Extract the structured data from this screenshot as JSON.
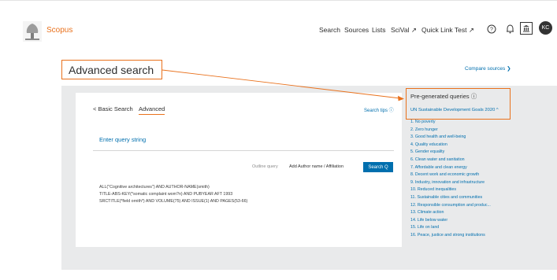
{
  "header": {
    "brand": "Scopus",
    "nav": [
      "Search",
      "Sources",
      "Lists",
      "SciVal ↗",
      "Quick Link Test ↗"
    ],
    "avatar_initials": "KC"
  },
  "page": {
    "title": "Advanced search",
    "compare_sources": "Compare sources ❯"
  },
  "search_card": {
    "tab_basic": "< Basic Search",
    "tab_advanced": "Advanced",
    "search_tips": "Search tips ⓘ",
    "query_placeholder": "Enter query string",
    "outline_query": "Outline query",
    "add_author": "Add Author name / Affiliation",
    "search_button": "Search Q",
    "examples": [
      "ALL(\"Cognitive architectures\") AND AUTHOR-NAME(smith)",
      "TITLE-ABS-KEY(*somatic complaint wom?n) AND PUBYEAR AFT 1993",
      "SRCTITLE(*field ornith*) AND VOLUME(75) AND ISSUE(1) AND PAGES(53-66)"
    ]
  },
  "pregenerated": {
    "title": "Pre-generated queries ⓘ",
    "subtitle": "UN Sustainable Development Goals 2020 ^",
    "goals": [
      "1. No poverty",
      "2. Zero hunger",
      "3. Good health and well-being",
      "4. Quality education",
      "5. Gender equality",
      "6. Clean water and sanitation",
      "7. Affordable and clean energy",
      "8. Decent work and economic growth",
      "9. Industry, innovation and infrastructure",
      "10. Reduced inequalities",
      "11. Sustainable cities and communities",
      "12. Responsible consumption and produc...",
      "13. Climate action",
      "14. Life below water",
      "15. Life on land",
      "16. Peace, justice and strong institutions"
    ]
  },
  "colors": {
    "accent": "#e9711c",
    "link": "#006fae",
    "panel": "#e9eaeb"
  }
}
